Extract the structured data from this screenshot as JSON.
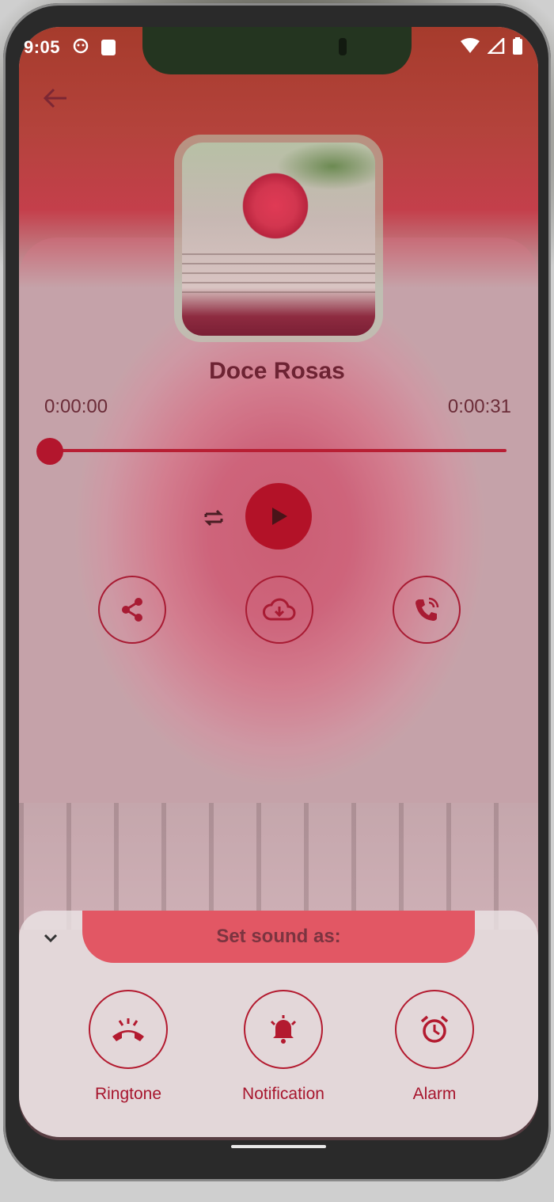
{
  "status_bar": {
    "time": "9:05"
  },
  "player": {
    "title": "Doce Rosas",
    "time_current": "0:00:00",
    "time_total": "0:00:31",
    "progress": 0.0
  },
  "sheet": {
    "heading": "Set sound as:",
    "options": [
      {
        "label": "Ringtone",
        "icon": "ringtone-icon"
      },
      {
        "label": "Notification",
        "icon": "bell-icon"
      },
      {
        "label": "Alarm",
        "icon": "alarm-clock-icon"
      }
    ]
  },
  "colors": {
    "accent": "#b31228",
    "title": "#6d2333",
    "sheet_pill": "#e25764"
  }
}
